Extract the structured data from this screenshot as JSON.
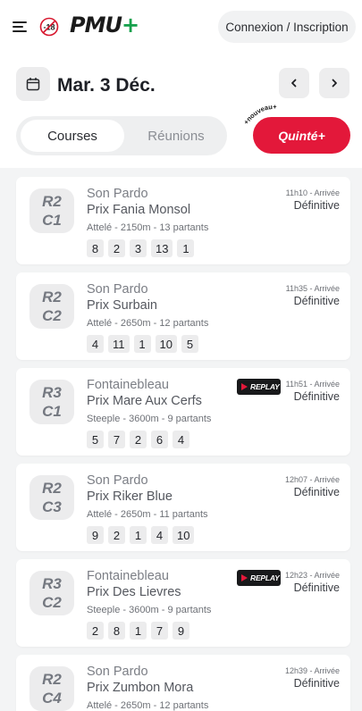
{
  "header": {
    "logo": "PMU",
    "logo_plus": "+",
    "age_badge": "-18",
    "login_label": "Connexion / Inscription"
  },
  "date_bar": {
    "date": "Mar. 3 Déc.",
    "tabs": [
      "Courses",
      "Réunions"
    ],
    "active_tab": "Courses",
    "quinte_label": "Quinté+",
    "nouveau_label": "+nouveau+"
  },
  "colors": {
    "accent_red": "#e3183a",
    "brand_green": "#14a04b"
  },
  "icons": [
    "hamburger-icon",
    "age-restriction-icon",
    "calendar-icon",
    "chevron-left-icon",
    "chevron-right-icon",
    "replay-icon"
  ],
  "races": [
    {
      "code1": "R2",
      "code2": "C1",
      "venue": "Son Pardo",
      "name": "Prix Fania Monsol",
      "details": "Attelé - 2150m - 13 partants",
      "result": [
        "8",
        "2",
        "3",
        "13",
        "1"
      ],
      "time": "11h10 - Arrivée",
      "status": "Définitive",
      "replay": false
    },
    {
      "code1": "R2",
      "code2": "C2",
      "venue": "Son Pardo",
      "name": "Prix Surbain",
      "details": "Attelé - 2650m - 12 partants",
      "result": [
        "4",
        "11",
        "1",
        "10",
        "5"
      ],
      "time": "11h35 - Arrivée",
      "status": "Définitive",
      "replay": false
    },
    {
      "code1": "R3",
      "code2": "C1",
      "venue": "Fontainebleau",
      "name": "Prix Mare Aux Cerfs",
      "details": "Steeple - 3600m - 9 partants",
      "result": [
        "5",
        "7",
        "2",
        "6",
        "4"
      ],
      "time": "11h51 - Arrivée",
      "status": "Définitive",
      "replay": true,
      "replay_label": "REPLAY"
    },
    {
      "code1": "R2",
      "code2": "C3",
      "venue": "Son Pardo",
      "name": "Prix Riker Blue",
      "details": "Attelé - 2650m - 11 partants",
      "result": [
        "9",
        "2",
        "1",
        "4",
        "10"
      ],
      "time": "12h07 - Arrivée",
      "status": "Définitive",
      "replay": false
    },
    {
      "code1": "R3",
      "code2": "C2",
      "venue": "Fontainebleau",
      "name": "Prix Des Lievres",
      "details": "Steeple - 3600m - 9 partants",
      "result": [
        "2",
        "8",
        "1",
        "7",
        "9"
      ],
      "time": "12h23 - Arrivée",
      "status": "Définitive",
      "replay": true,
      "replay_label": "REPLAY"
    },
    {
      "code1": "R2",
      "code2": "C4",
      "venue": "Son Pardo",
      "name": "Prix Zumbon Mora",
      "details": "Attelé - 2650m - 12 partants",
      "result": [],
      "time": "12h39 - Arrivée",
      "status": "Définitive",
      "replay": false
    }
  ]
}
